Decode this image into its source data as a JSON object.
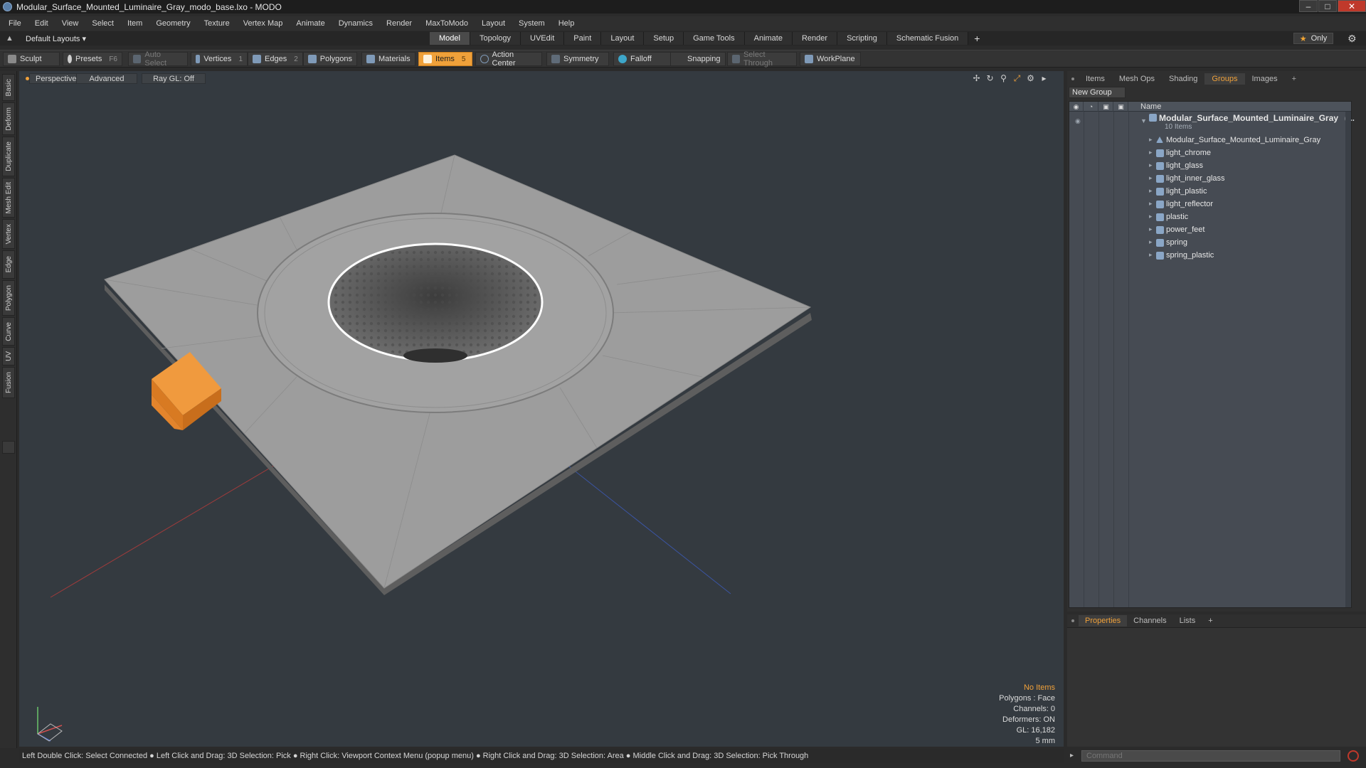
{
  "window": {
    "title": "Modular_Surface_Mounted_Luminaire_Gray_modo_base.lxo - MODO",
    "controls": [
      "–",
      "□",
      "✕"
    ]
  },
  "menu": [
    "File",
    "Edit",
    "View",
    "Select",
    "Item",
    "Geometry",
    "Texture",
    "Vertex Map",
    "Animate",
    "Dynamics",
    "Render",
    "MaxToModo",
    "Layout",
    "System",
    "Help"
  ],
  "layout": {
    "current": "Default Layouts ▾",
    "tabs": [
      "Model",
      "Topology",
      "UVEdit",
      "Paint",
      "Layout",
      "Setup",
      "Game Tools",
      "Animate",
      "Render",
      "Scripting",
      "Schematic Fusion"
    ],
    "active_tab": "Model",
    "add_tab": "+",
    "only_label": "Only"
  },
  "toolbar": {
    "sculpt": "Sculpt",
    "presets": "Presets",
    "presets_key": "F6",
    "auto_select": "Auto Select",
    "vertices": "Vertices",
    "vertices_num": "1",
    "edges": "Edges",
    "edges_num": "2",
    "polygons": "Polygons",
    "materials": "Materials",
    "items": "Items",
    "items_num": "5",
    "action_center": "Action Center",
    "symmetry": "Symmetry",
    "falloff": "Falloff",
    "snapping": "Snapping",
    "select_through": "Select Through",
    "workplane": "WorkPlane"
  },
  "left_tabs": [
    "Basic",
    "Deform",
    "Duplicate",
    "Mesh Edit",
    "Vertex",
    "Edge",
    "Polygon",
    "Curve",
    "UV",
    "Fusion"
  ],
  "viewport": {
    "perspective": "Perspective",
    "advanced": "Advanced",
    "raygl": "Ray GL: Off",
    "stats": {
      "no_items": "No Items",
      "polygons": "Polygons : Face",
      "channels": "Channels: 0",
      "deformers": "Deformers: ON",
      "gl": "GL: 16,182",
      "scale": "5 mm"
    }
  },
  "status_bar": "Left Double Click: Select Connected ● Left Click and Drag: 3D Selection: Pick ● Right Click: Viewport Context Menu (popup menu) ● Right Click and Drag: 3D Selection: Area ● Middle Click and Drag: 3D Selection: Pick Through",
  "right_panel": {
    "tabs": [
      "Items",
      "Mesh Ops",
      "Shading",
      "Groups",
      "Images"
    ],
    "active_tab": "Groups",
    "add_tab": "+",
    "new_group": "New Group",
    "name_header": "Name",
    "group_name": "Modular_Surface_Mounted_Luminaire_Gray",
    "group_name_suffix": "(...",
    "group_count": "10 Items",
    "items": [
      "Modular_Surface_Mounted_Luminaire_Gray",
      "light_chrome",
      "light_glass",
      "light_inner_glass",
      "light_plastic",
      "light_reflector",
      "plastic",
      "power_feet",
      "spring",
      "spring_plastic"
    ]
  },
  "bottom_panel": {
    "tabs": [
      "Properties",
      "Channels",
      "Lists"
    ],
    "active_tab": "Properties",
    "add_tab": "+",
    "command_placeholder": "Command"
  },
  "colors": {
    "accent": "#f0a13a",
    "viewport_bg": "#343a40",
    "mesh": "#9a9a9a",
    "selection_orange": "#f08a30"
  }
}
